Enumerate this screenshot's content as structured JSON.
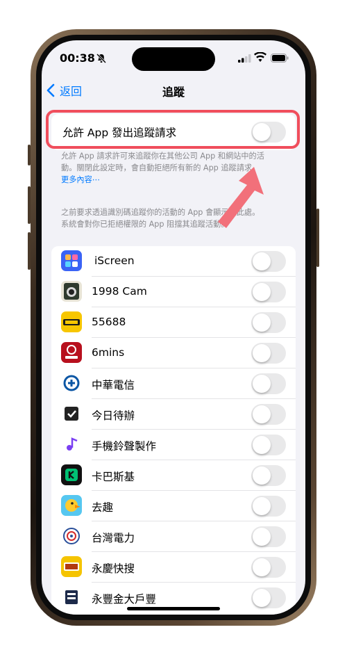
{
  "status": {
    "time": "00:38"
  },
  "nav": {
    "back_label": "返回",
    "title": "追蹤"
  },
  "tracking_toggle": {
    "label": "允許 App 發出追蹤請求",
    "footer_line1": "允許 App 請求許可來追蹤你在其他公司 App 和網站中的活",
    "footer_line2": "動。關閉此設定時，會自動拒絕所有新的 App 追蹤請求。",
    "more_link": "更多內容⋯",
    "info_line1": "之前要求透過識別碼追蹤你的活動的 App 會顯示在此處。",
    "info_line2": "系統會對你已拒絕權限的 App 阻擋其追蹤活動。"
  },
  "apps": [
    {
      "name": "iScreen"
    },
    {
      "name": "1998 Cam"
    },
    {
      "name": "55688"
    },
    {
      "name": "6mins"
    },
    {
      "name": "中華電信"
    },
    {
      "name": "今日待辦"
    },
    {
      "name": "手機鈴聲製作"
    },
    {
      "name": "卡巴斯基"
    },
    {
      "name": "去趣"
    },
    {
      "name": "台灣電力"
    },
    {
      "name": "永慶快搜"
    },
    {
      "name": "永豐金大戶豐"
    }
  ],
  "icons": {
    "app0": "iscreen-icon",
    "app1": "camera-icon",
    "app2": "55688-icon",
    "app3": "6mins-icon",
    "app4": "cht-icon",
    "app5": "checkbox-icon",
    "app6": "ringtone-icon",
    "app7": "kaspersky-icon",
    "app8": "bird-icon",
    "app9": "taipower-icon",
    "app10": "yungching-icon",
    "app11": "sinopac-icon"
  },
  "colors": {
    "accent": "#007aff",
    "highlight": "#f04e5c",
    "arrow": "#f2707a"
  }
}
